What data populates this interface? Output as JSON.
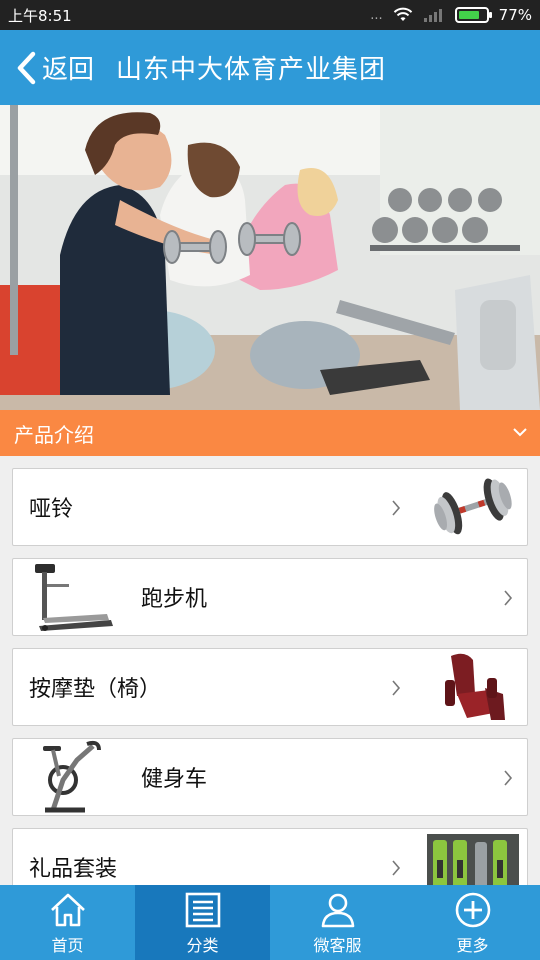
{
  "status": {
    "time": "上午8:51",
    "dots": "...",
    "battery": "77%",
    "battery_level": 0.77
  },
  "header": {
    "back_label": "返回",
    "title": "山东中大体育产业集团"
  },
  "section": {
    "title": "产品介绍"
  },
  "products": [
    {
      "label": "哑铃",
      "icon": "dumbbell-icon"
    },
    {
      "label": "跑步机",
      "icon": "treadmill-icon"
    },
    {
      "label": "按摩垫（椅）",
      "icon": "massage-chair-icon"
    },
    {
      "label": "健身车",
      "icon": "exercise-bike-icon"
    },
    {
      "label": "礼品套装",
      "icon": "gift-set-icon"
    }
  ],
  "tabs": [
    {
      "label": "首页",
      "icon": "home-icon"
    },
    {
      "label": "分类",
      "icon": "list-icon",
      "active": true
    },
    {
      "label": "微客服",
      "icon": "user-icon"
    },
    {
      "label": "更多",
      "icon": "plus-icon"
    }
  ],
  "colors": {
    "primary": "#2f9ad8",
    "tab_active": "#1878bc",
    "section": "#fa8843"
  }
}
